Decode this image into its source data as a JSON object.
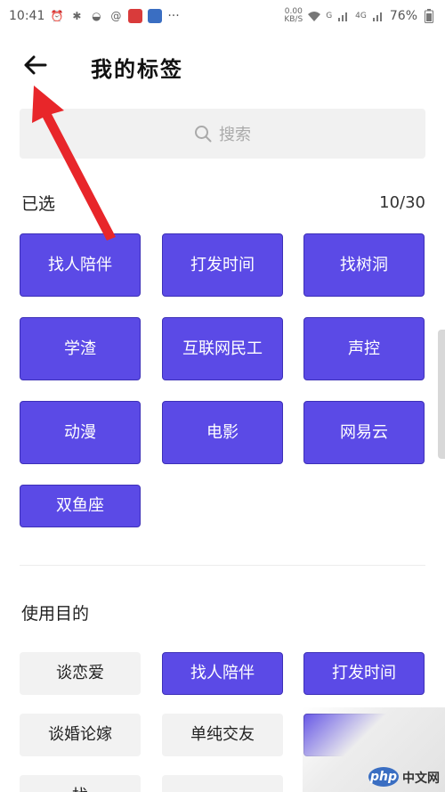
{
  "status_bar": {
    "time": "10:41",
    "net_speed": "0.00",
    "net_unit": "KB/S",
    "signal_1": "G",
    "signal_2": "4G",
    "battery": "76%",
    "more": "···"
  },
  "header": {
    "back_icon": "arrow-left-icon",
    "title": "我的标签"
  },
  "search": {
    "icon": "search-icon",
    "placeholder": "搜索"
  },
  "selected": {
    "label": "已选",
    "count": "10/30",
    "tags": [
      "找人陪伴",
      "打发时间",
      "找树洞",
      "学渣",
      "互联网民工",
      "声控",
      "动漫",
      "电影",
      "网易云",
      "双鱼座"
    ]
  },
  "purpose": {
    "label": "使用目的",
    "tags": [
      {
        "label": "谈恋爱",
        "selected": false
      },
      {
        "label": "找人陪伴",
        "selected": true
      },
      {
        "label": "打发时间",
        "selected": true
      },
      {
        "label": "谈婚论嫁",
        "selected": false
      },
      {
        "label": "单纯交友",
        "selected": false
      },
      {
        "label": "",
        "selected": true
      },
      {
        "label": "找",
        "selected": false
      }
    ]
  },
  "colors": {
    "accent": "#5b4ae6",
    "annotation_arrow": "#e8262a",
    "chip_unselected": "#f2f2f2"
  },
  "watermark": {
    "logo": "php",
    "text": "中文网"
  }
}
